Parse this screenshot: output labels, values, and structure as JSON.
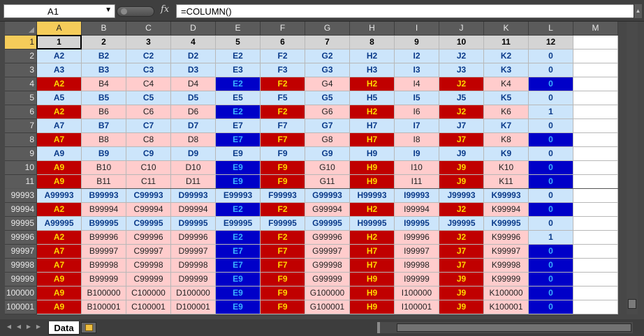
{
  "namebox": {
    "value": "A1"
  },
  "formula": {
    "value": "=COLUMN()"
  },
  "columns": [
    "A",
    "B",
    "C",
    "D",
    "E",
    "F",
    "G",
    "H",
    "I",
    "J",
    "K",
    "L",
    "M"
  ],
  "row1": [
    "1",
    "2",
    "3",
    "4",
    "5",
    "6",
    "7",
    "8",
    "9",
    "10",
    "11",
    "12"
  ],
  "rows": [
    {
      "n": "2",
      "cells": [
        "A2",
        "B2",
        "C2",
        "D2",
        "E2",
        "F2",
        "G2",
        "H2",
        "I2",
        "J2",
        "K2",
        "0"
      ]
    },
    {
      "n": "3",
      "cells": [
        "A3",
        "B3",
        "C3",
        "D3",
        "E3",
        "F3",
        "G3",
        "H3",
        "I3",
        "J3",
        "K3",
        "0"
      ]
    },
    {
      "n": "4",
      "cells": [
        "A2",
        "B4",
        "C4",
        "D4",
        "E2",
        "F2",
        "G4",
        "H2",
        "I4",
        "J2",
        "K4",
        "0"
      ]
    },
    {
      "n": "5",
      "cells": [
        "A5",
        "B5",
        "C5",
        "D5",
        "E5",
        "F5",
        "G5",
        "H5",
        "I5",
        "J5",
        "K5",
        "0"
      ]
    },
    {
      "n": "6",
      "cells": [
        "A2",
        "B6",
        "C6",
        "D6",
        "E2",
        "F2",
        "G6",
        "H2",
        "I6",
        "J2",
        "K6",
        "1"
      ]
    },
    {
      "n": "7",
      "cells": [
        "A7",
        "B7",
        "C7",
        "D7",
        "E7",
        "F7",
        "G7",
        "H7",
        "I7",
        "J7",
        "K7",
        "0"
      ]
    },
    {
      "n": "8",
      "cells": [
        "A7",
        "B8",
        "C8",
        "D8",
        "E7",
        "F7",
        "G8",
        "H7",
        "I8",
        "J7",
        "K8",
        "0"
      ]
    },
    {
      "n": "9",
      "cells": [
        "A9",
        "B9",
        "C9",
        "D9",
        "E9",
        "F9",
        "G9",
        "H9",
        "I9",
        "J9",
        "K9",
        "0"
      ]
    },
    {
      "n": "10",
      "cells": [
        "A9",
        "B10",
        "C10",
        "D10",
        "E9",
        "F9",
        "G10",
        "H9",
        "I10",
        "J9",
        "K10",
        "0"
      ]
    },
    {
      "n": "11",
      "cells": [
        "A9",
        "B11",
        "C11",
        "D11",
        "E9",
        "F9",
        "G11",
        "H9",
        "I11",
        "J9",
        "K11",
        "0"
      ]
    },
    {
      "n": "99993",
      "cells": [
        "A99993",
        "B99993",
        "C99993",
        "D99993",
        "E99993",
        "F99993",
        "G99993",
        "H99993",
        "I99993",
        "J99993",
        "K99993",
        "0"
      ]
    },
    {
      "n": "99994",
      "cells": [
        "A2",
        "B99994",
        "C99994",
        "D99994",
        "E2",
        "F2",
        "G99994",
        "H2",
        "I99994",
        "J2",
        "K99994",
        "0"
      ]
    },
    {
      "n": "99995",
      "cells": [
        "A99995",
        "B99995",
        "C99995",
        "D99995",
        "E99995",
        "F99995",
        "G99995",
        "H99995",
        "I99995",
        "J99995",
        "K99995",
        "0"
      ]
    },
    {
      "n": "99996",
      "cells": [
        "A2",
        "B99996",
        "C99996",
        "D99996",
        "E2",
        "F2",
        "G99996",
        "H2",
        "I99996",
        "J2",
        "K99996",
        "1"
      ]
    },
    {
      "n": "99997",
      "cells": [
        "A7",
        "B99997",
        "C99997",
        "D99997",
        "E7",
        "F7",
        "G99997",
        "H7",
        "I99997",
        "J7",
        "K99997",
        "0"
      ]
    },
    {
      "n": "99998",
      "cells": [
        "A7",
        "B99998",
        "C99998",
        "D99998",
        "E7",
        "F7",
        "G99998",
        "H7",
        "I99998",
        "J7",
        "K99998",
        "0"
      ]
    },
    {
      "n": "99999",
      "cells": [
        "A9",
        "B99999",
        "C99999",
        "D99999",
        "E9",
        "F9",
        "G99999",
        "H9",
        "I99999",
        "J9",
        "K99999",
        "0"
      ]
    },
    {
      "n": "100000",
      "cells": [
        "A9",
        "B100000",
        "C100000",
        "D100000",
        "E9",
        "F9",
        "G100000",
        "H9",
        "I100000",
        "J9",
        "K100000",
        "0"
      ]
    },
    {
      "n": "100001",
      "cells": [
        "A9",
        "B100001",
        "C100001",
        "D100001",
        "E9",
        "F9",
        "G100001",
        "H9",
        "I100001",
        "J9",
        "K100001",
        "0"
      ]
    }
  ],
  "sheet_tab": {
    "label": "Data"
  },
  "colors": {
    "red": "#c00000",
    "gold": "#ffd700",
    "blue": "#0000c8",
    "cyan": "#3ab0ff",
    "pink": "#ffcccc",
    "light_blue": "#cce5fb",
    "header_selected": "#f5cc5a"
  }
}
